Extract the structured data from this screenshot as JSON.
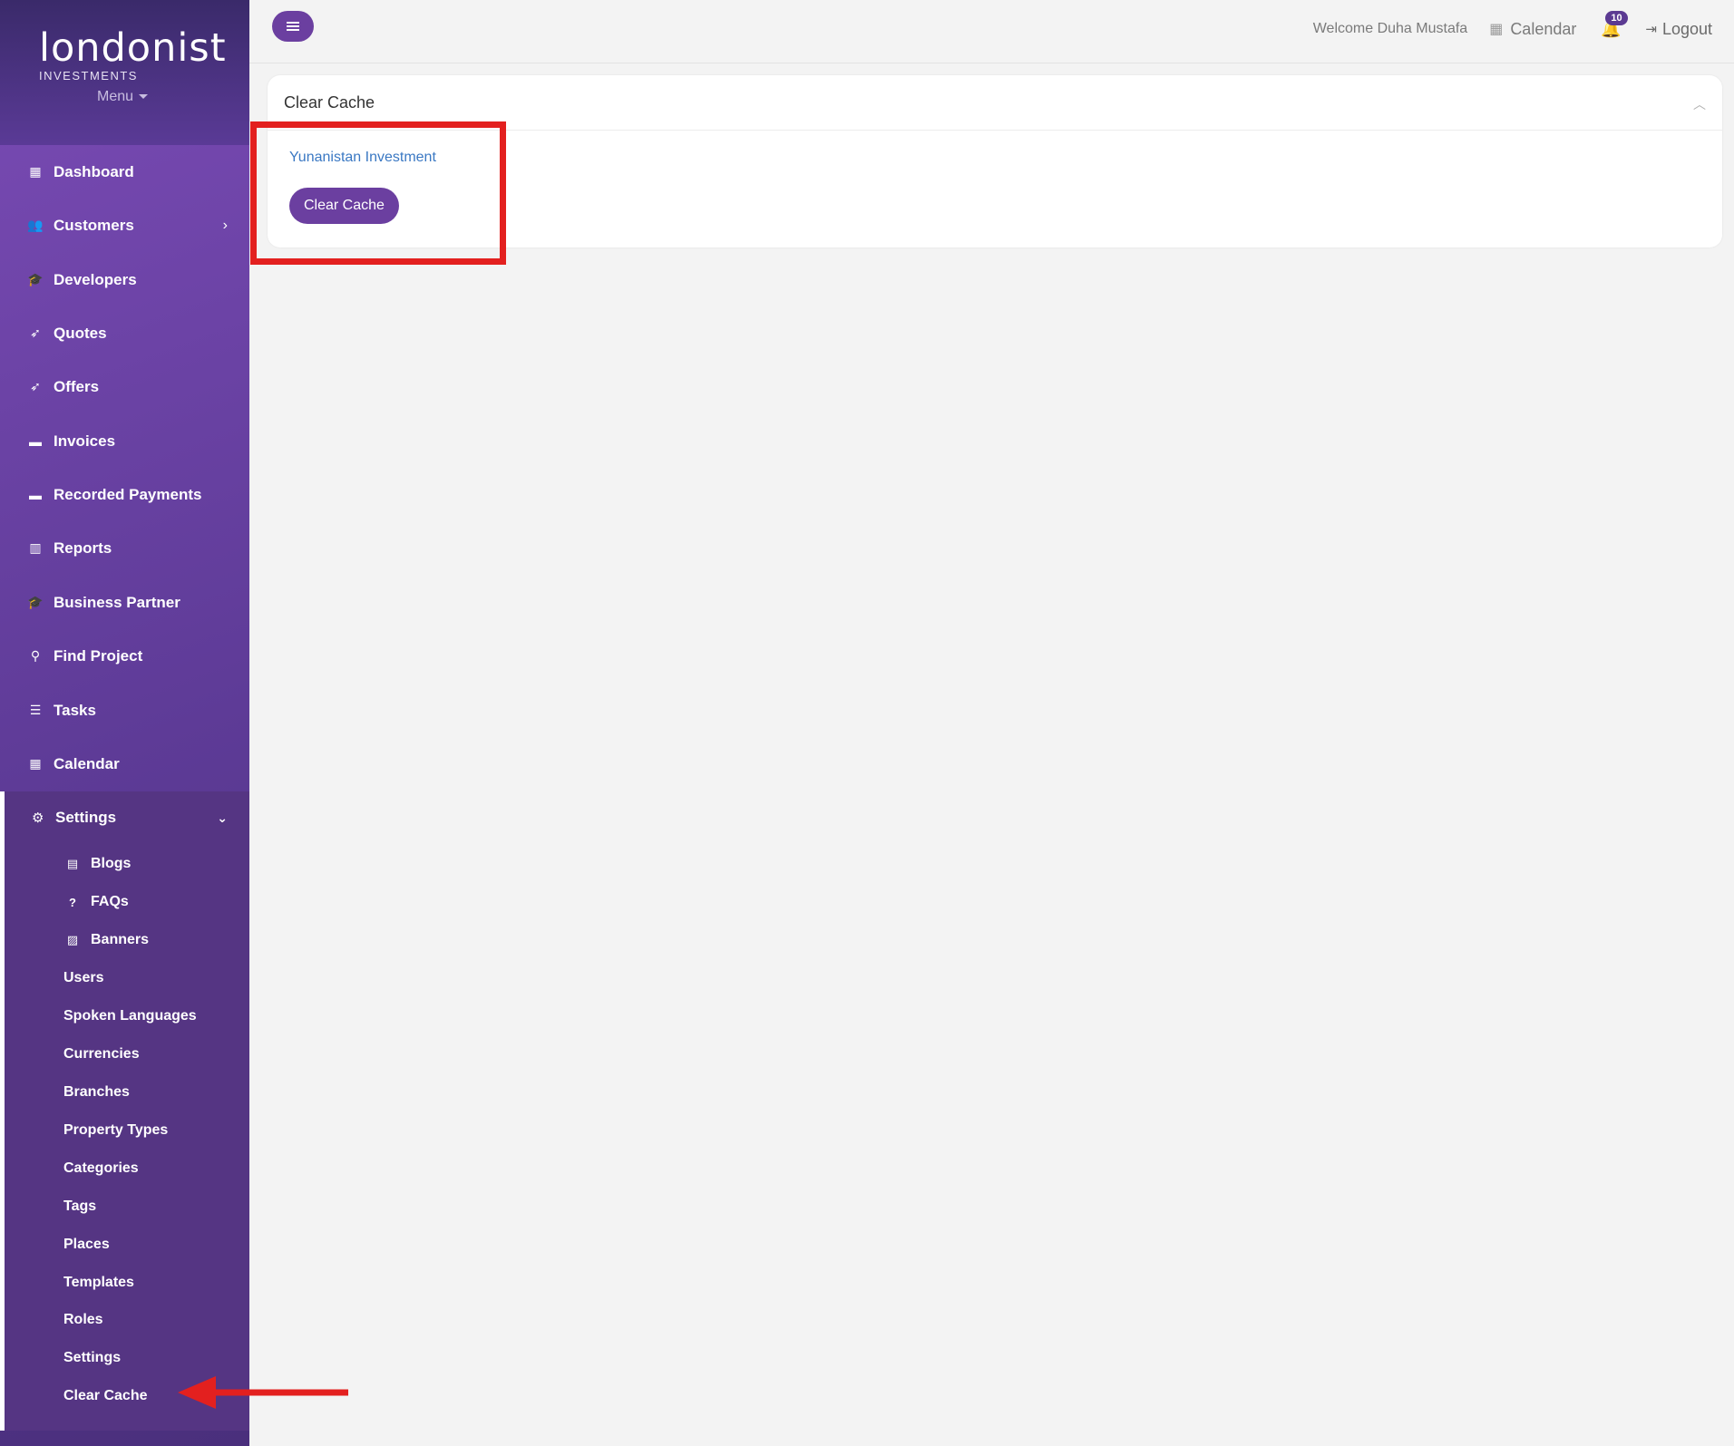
{
  "brand": {
    "logo_text": "londonist",
    "logo_sub": "INVESTMENTS",
    "menu_label": "Menu"
  },
  "nav": [
    {
      "label": "Dashboard",
      "icon": "dashboard-icon"
    },
    {
      "label": "Customers",
      "icon": "users-icon"
    },
    {
      "label": "Developers",
      "icon": "graduation-cap-icon"
    },
    {
      "label": "Quotes",
      "icon": "rocket-icon"
    },
    {
      "label": "Offers",
      "icon": "rocket-icon"
    },
    {
      "label": "Invoices",
      "icon": "credit-card-icon"
    },
    {
      "label": "Recorded Payments",
      "icon": "credit-card-icon"
    },
    {
      "label": "Reports",
      "icon": "bar-chart-icon"
    },
    {
      "label": "Business Partner",
      "icon": "graduation-cap-icon"
    },
    {
      "label": "Find Project",
      "icon": "search-icon"
    },
    {
      "label": "Tasks",
      "icon": "tasks-icon"
    },
    {
      "label": "Calendar",
      "icon": "calendar-icon"
    }
  ],
  "settings": {
    "label": "Settings",
    "icon": "gear-icon",
    "items": [
      {
        "label": "Blogs",
        "icon": "newspaper-icon"
      },
      {
        "label": "FAQs",
        "icon": "question-circle-icon"
      },
      {
        "label": "Banners",
        "icon": "image-icon"
      },
      {
        "label": "Users"
      },
      {
        "label": "Spoken Languages"
      },
      {
        "label": "Currencies"
      },
      {
        "label": "Branches"
      },
      {
        "label": "Property Types"
      },
      {
        "label": "Categories"
      },
      {
        "label": "Tags"
      },
      {
        "label": "Places"
      },
      {
        "label": "Templates"
      },
      {
        "label": "Roles"
      },
      {
        "label": "Settings"
      },
      {
        "label": "Clear Cache",
        "active": true
      }
    ]
  },
  "topbar": {
    "welcome": "Welcome Duha Mustafa",
    "calendar_label": "Calendar",
    "notification_count": "10",
    "logout_label": "Logout"
  },
  "card": {
    "title": "Clear Cache",
    "link_text": "Yunanistan Investment",
    "button_label": "Clear Cache"
  },
  "colors": {
    "accent": "#6b3fa0",
    "sidebar_dark": "#553583",
    "annotation_red": "#e3201f",
    "link": "#3a78c3"
  }
}
